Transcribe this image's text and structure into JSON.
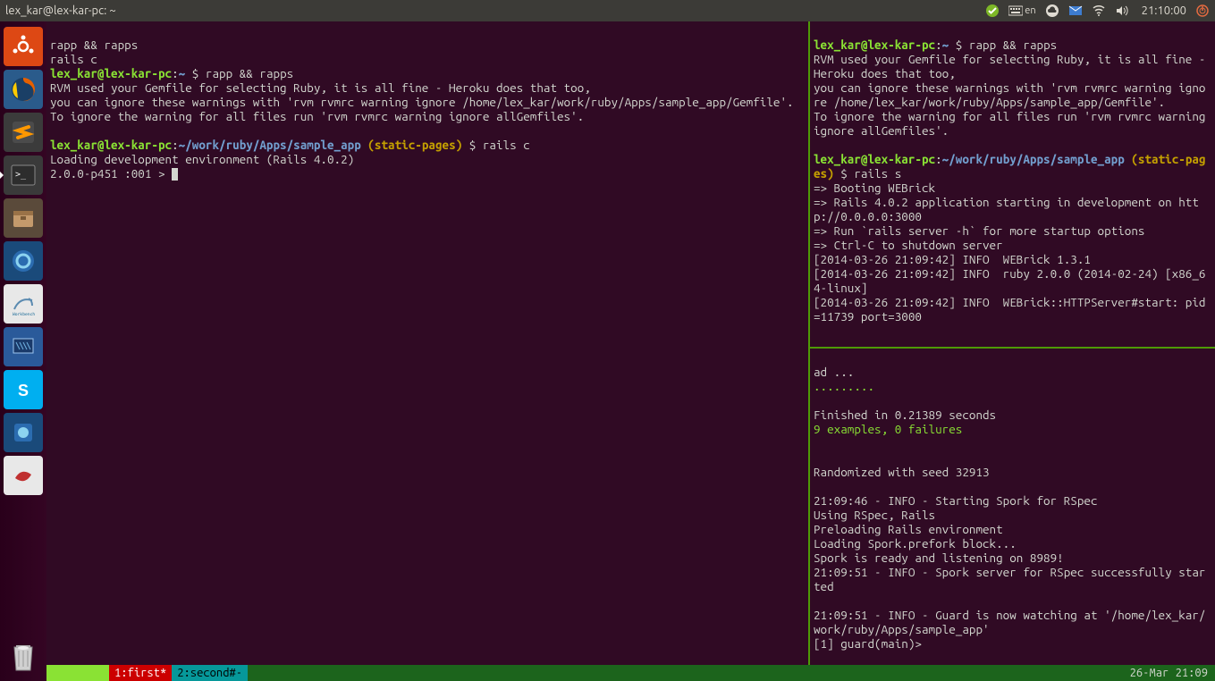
{
  "window_title": "lex_kar@lex-kar-pc: ~",
  "tray": {
    "lang": "en",
    "time": "21:10:00"
  },
  "left_pane": {
    "l1": "rapp && rapps",
    "l2": "rails c",
    "p1_user": "lex_kar@lex-kar-pc",
    "p1_path": "~",
    "p1_cmd": "rapp && rapps",
    "msg1": "RVM used your Gemfile for selecting Ruby, it is all fine - Heroku does that too,",
    "msg2": "you can ignore these warnings with 'rvm rvmrc warning ignore /home/lex_kar/work/ruby/Apps/sample_app/Gemfile'.",
    "msg3": "To ignore the warning for all files run 'rvm rvmrc warning ignore allGemfiles'.",
    "p2_path": "~/work/ruby/Apps/sample_app",
    "p2_branch": "(static-pages)",
    "p2_cmd": "rails c",
    "load": "Loading development environment (Rails 4.0.2)",
    "irb": "2.0.0-p451 :001 > "
  },
  "right_top": {
    "p1_user": "lex_kar@lex-kar-pc",
    "p1_path": "~",
    "p1_cmd": "rapp && rapps",
    "msg1": "RVM used your Gemfile for selecting Ruby, it is all fine - Heroku does that too,",
    "msg2": "you can ignore these warnings with 'rvm rvmrc warning ignore /home/lex_kar/work/ruby/Apps/sample_app/Gemfile'.",
    "msg3": "To ignore the warning for all files run 'rvm rvmrc warning ignore allGemfiles'.",
    "p2_path": "~/work/ruby/Apps/sample_app",
    "p2_branch": "(static-pages)",
    "p2_cmd": "rails s",
    "l1": "=> Booting WEBrick",
    "l2": "=> Rails 4.0.2 application starting in development on http://0.0.0.0:3000",
    "l3": "=> Run `rails server -h` for more startup options",
    "l4": "=> Ctrl-C to shutdown server",
    "l5": "[2014-03-26 21:09:42] INFO  WEBrick 1.3.1",
    "l6": "[2014-03-26 21:09:42] INFO  ruby 2.0.0 (2014-02-24) [x86_64-linux]",
    "l7": "[2014-03-26 21:09:42] INFO  WEBrick::HTTPServer#start: pid=11739 port=3000"
  },
  "right_bottom": {
    "l1": "ad ...",
    "dots": ".........",
    "fin": "Finished in 0.21389 seconds",
    "res": "9 examples, 0 failures",
    "rand": "Randomized with seed 32913",
    "s1": "21:09:46 - INFO - Starting Spork for RSpec",
    "s2": "Using RSpec, Rails",
    "s3": "Preloading Rails environment",
    "s4": "Loading Spork.prefork block...",
    "s5": "Spork is ready and listening on 8989!",
    "s6": "21:09:51 - INFO - Spork server for RSpec successfully started",
    "s7": "21:09:51 - INFO - Guard is now watching at '/home/lex_kar/work/ruby/Apps/sample_app'",
    "prompt": "[1] guard(main)>"
  },
  "tmux": {
    "tab1": "1:first*",
    "tab2": "2:second#-",
    "date": "26-Mar 21:09"
  }
}
